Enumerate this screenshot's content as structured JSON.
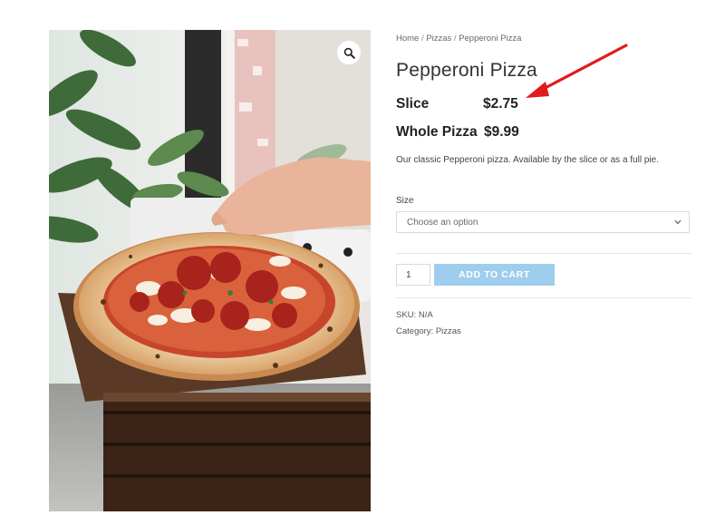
{
  "breadcrumb": {
    "home": "Home",
    "sep": " / ",
    "category": "Pizzas",
    "current": "Pepperoni Pizza"
  },
  "product": {
    "title": "Pepperoni Pizza",
    "prices": [
      {
        "label": "Slice",
        "value": "$2.75"
      },
      {
        "label": "Whole Pizza",
        "value": "$9.99"
      }
    ],
    "description": "Our classic Pepperoni pizza. Available by the slice or as a full pie.",
    "size_label": "Size",
    "size_placeholder": "Choose an option",
    "quantity": "1",
    "add_to_cart": "ADD TO CART",
    "sku_label": "SKU:",
    "sku_value": "N/A",
    "category_label": "Category:",
    "category_value": "Pizzas"
  },
  "icons": {
    "zoom": "search-icon",
    "select_caret": "chevron-down-icon",
    "annotation": "red-arrow"
  },
  "colors": {
    "button": "#9fcdee",
    "arrow": "#e01b1b"
  }
}
